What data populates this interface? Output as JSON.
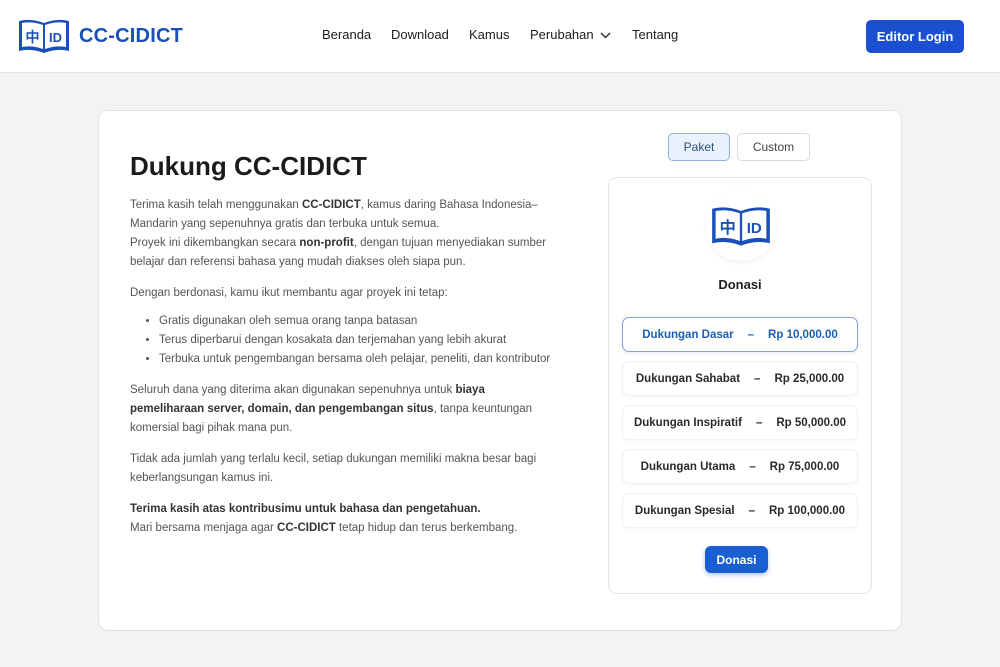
{
  "header": {
    "logo_text": "CC-CIDICT",
    "logo_glyph_left": "中",
    "logo_glyph_right": "ID",
    "nav": [
      "Beranda",
      "Download",
      "Kamus",
      "Perubahan",
      "Tentang"
    ],
    "login_label": "Editor Login"
  },
  "main": {
    "title": "Dukung CC-CIDICT",
    "p1_a": "Terima kasih telah menggunakan ",
    "p1_b": "CC-CIDICT",
    "p1_c": ", kamus daring Bahasa Indonesia–Mandarin yang sepenuhnya gratis dan terbuka untuk semua.",
    "p1_d": "Proyek ini dikembangkan secara ",
    "p1_e": "non-profit",
    "p1_f": ", dengan tujuan menyediakan sumber belajar dan referensi bahasa yang mudah diakses oleh siapa pun.",
    "p2": "Dengan berdonasi, kamu ikut membantu agar proyek ini tetap:",
    "bullets": [
      "Gratis digunakan oleh semua orang tanpa batasan",
      "Terus diperbarui dengan kosakata dan terjemahan yang lebih akurat",
      "Terbuka untuk pengembangan bersama oleh pelajar, peneliti, dan kontributor"
    ],
    "p3_a": "Seluruh dana yang diterima akan digunakan sepenuhnya untuk ",
    "p3_b": "biaya pemeliharaan server, domain, dan pengembangan situs",
    "p3_c": ", tanpa keuntungan komersial bagi pihak mana pun.",
    "p4": "Tidak ada jumlah yang terlalu kecil, setiap dukungan memiliki makna besar bagi keberlangsungan kamus ini.",
    "p5_a": "Terima kasih atas kontribusimu untuk bahasa dan pengetahuan.",
    "p5_b": "Mari bersama menjaga agar ",
    "p5_c": "CC-CIDICT",
    "p5_d": " tetap hidup dan terus berkembang."
  },
  "donation": {
    "tabs": [
      "Paket",
      "Custom"
    ],
    "active_tab": "Paket",
    "icon_glyph_left": "中",
    "icon_glyph_right": "ID",
    "title": "Donasi",
    "separator": "–",
    "tiers": [
      {
        "name": "Dukungan Dasar",
        "amount": "Rp 10,000.00",
        "selected": true
      },
      {
        "name": "Dukungan Sahabat",
        "amount": "Rp 25,000.00",
        "selected": false
      },
      {
        "name": "Dukungan Inspiratif",
        "amount": "Rp 50,000.00",
        "selected": false
      },
      {
        "name": "Dukungan Utama",
        "amount": "Rp 75,000.00",
        "selected": false
      },
      {
        "name": "Dukungan Spesial",
        "amount": "Rp 100,000.00",
        "selected": false
      }
    ],
    "button_label": "Donasi"
  },
  "colors": {
    "brand": "#1a4fb8",
    "button": "#1a4fcf",
    "selected_tier": "#1d5fb0"
  }
}
